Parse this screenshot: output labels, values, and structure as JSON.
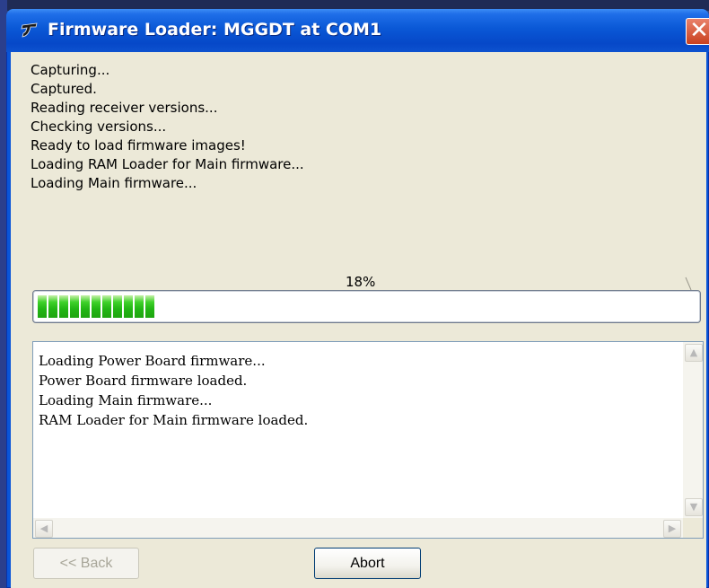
{
  "window": {
    "title": "Firmware Loader:  MGGDT at COM1",
    "close_label": "✕"
  },
  "status": {
    "lines": [
      "Capturing...",
      "Captured.",
      "Reading receiver versions...",
      "Checking versions...",
      "Ready to load firmware images!",
      "Loading RAM Loader for Main firmware...",
      "Loading Main firmware..."
    ]
  },
  "progress": {
    "label": "18%",
    "value": 18,
    "color": "#22b614"
  },
  "log": {
    "lines": [
      "Loading Power Board firmware...",
      "Power Board firmware loaded.",
      "Loading Main firmware...",
      "RAM Loader for Main firmware loaded."
    ]
  },
  "buttons": {
    "back_label": "<< Back",
    "abort_label": "Abort"
  }
}
